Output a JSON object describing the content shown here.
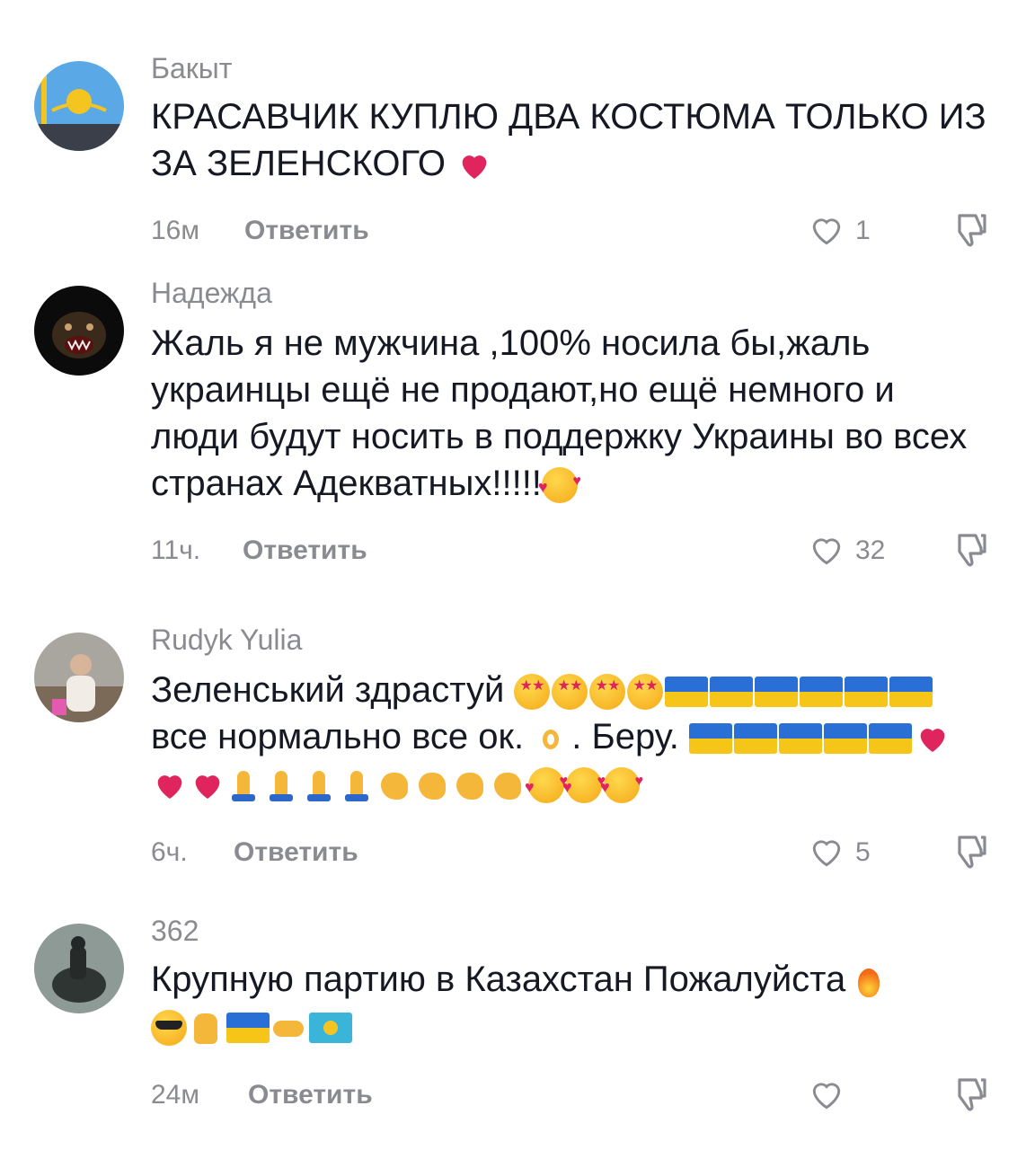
{
  "comments": [
    {
      "username": "Бакыт",
      "text": "КРАСАВЧИК КУПЛЮ ДВА КОСТЮМА ТОЛЬКО ИЗ ЗА ЗЕЛЕНСКОГО",
      "time": "16м",
      "reply_label": "Ответить",
      "likes": "1",
      "avatar_icon": "kazakhstan-flag-avatar"
    },
    {
      "username": "Надежда",
      "text": "Жаль я не мужчина ,100% носила бы,жаль украинцы ещё не продают,но ещё немного и люди будут носить в поддержку Украины во всех странах Адекватных!!!!!",
      "time": "11ч.",
      "reply_label": "Ответить",
      "likes": "32",
      "avatar_icon": "dog-avatar"
    },
    {
      "username": "Rudyk Yulia",
      "text_part1": "Зеленський здрастуй",
      "text_part2": "все нормально все ок.",
      "text_part3": ". Беру.",
      "time": "6ч.",
      "reply_label": "Ответить",
      "likes": "5",
      "avatar_icon": "person-photo-avatar"
    },
    {
      "username": "362",
      "text": "Крупную партию в Казахстан Пожалуйста",
      "time": "24м",
      "reply_label": "Ответить",
      "likes": "",
      "avatar_icon": "rider-avatar"
    }
  ],
  "icons": {
    "like": "heart-outline-icon",
    "dislike": "thumbs-down-icon"
  },
  "colors": {
    "text_primary": "#161823",
    "text_secondary": "#8a8b91",
    "heart_red": "#e0245e",
    "ua_blue": "#2a6fd6",
    "ua_yellow": "#f5c518"
  }
}
